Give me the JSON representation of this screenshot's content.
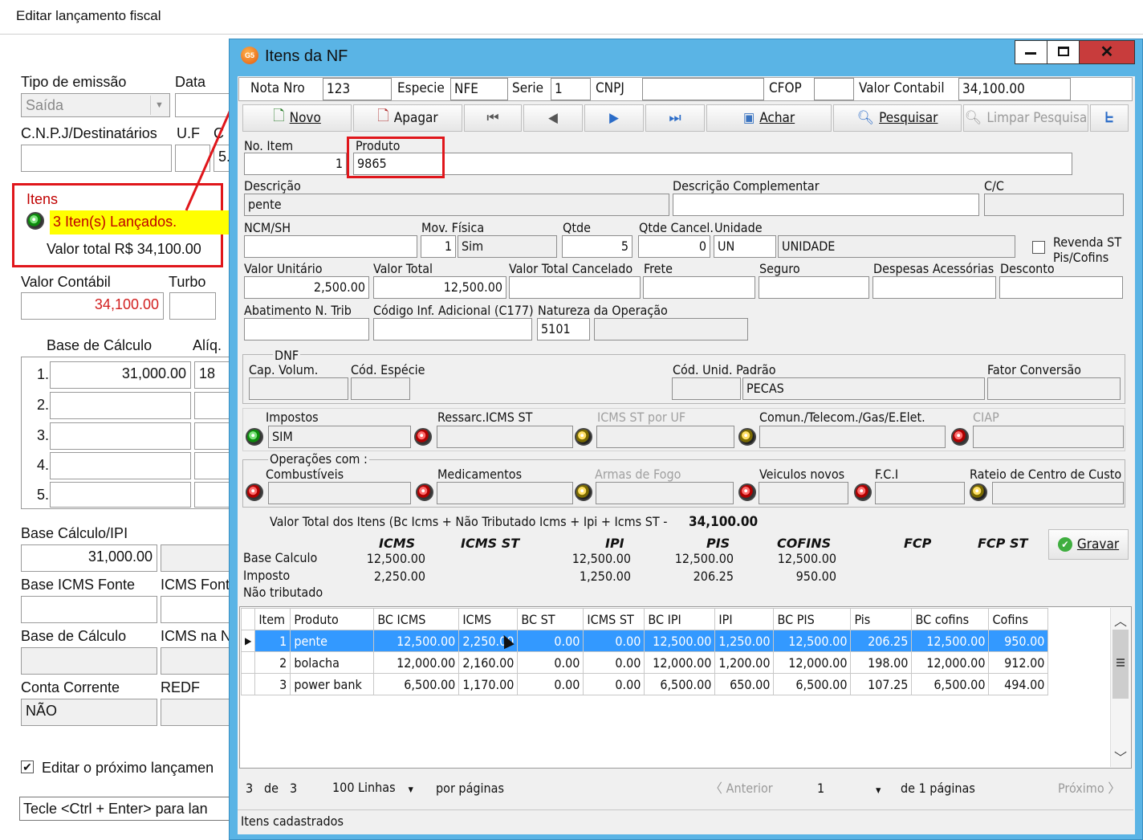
{
  "bg": {
    "title": "Editar lançamento fiscal",
    "tipo_emissao_label": "Tipo de emissão",
    "tipo_emissao_value": "Saída",
    "data_label": "Data",
    "cnpj_label": "C.N.P.J/Destinatários",
    "uf_label": "U.F",
    "c_label": "C",
    "s_value": "5.",
    "itens_label": "Itens",
    "itens_status": "3 Iten(s) Lançados.",
    "valor_total": "Valor total R$ 34,100.00",
    "valor_contabil_label": "Valor Contábil",
    "turbo_label": "Turbo",
    "valor_contabil_value": "34,100.00",
    "base_calc_label": "Base de Cálculo",
    "aliq_label": "Alíq.",
    "rows": [
      {
        "n": "1.",
        "base": "31,000.00",
        "aliq": "18"
      },
      {
        "n": "2.",
        "base": "",
        "aliq": ""
      },
      {
        "n": "3.",
        "base": "",
        "aliq": ""
      },
      {
        "n": "4.",
        "base": "",
        "aliq": ""
      },
      {
        "n": "5.",
        "base": "",
        "aliq": ""
      }
    ],
    "base_ipi_label": "Base Cálculo/IPI",
    "base_ipi_value": "31,000.00",
    "base_icms_fonte_label": "Base ICMS Fonte",
    "icms_fonte_label": "ICMS Font",
    "base_calc2_label": "Base de Cálculo",
    "icms_na_label": "ICMS na N",
    "conta_corrente_label": "Conta Corrente",
    "redf_label": "REDF",
    "conta_corrente_value": "NÃO",
    "editar_proximo": "Editar o próximo lançamen",
    "hint": "Tecle <Ctrl + Enter> para lan"
  },
  "dialog": {
    "title": "Itens da NF",
    "icon_text": "G5",
    "header": {
      "nota_label": "Nota Nro",
      "nota_value": "123",
      "especie_label": "Especie",
      "especie_value": "NFE",
      "serie_label": "Serie",
      "serie_value": "1",
      "cnpj_label": "CNPJ",
      "cnpj_value": "",
      "cfop_label": "CFOP",
      "cfop_value": "",
      "valor_contabil_label": "Valor Contabil",
      "valor_contabil_value": "34,100.00"
    },
    "toolbar": {
      "novo": "Novo",
      "apagar": "Apagar",
      "achar": "Achar",
      "pesquisar": "Pesquisar",
      "limpar": "Limpar Pesquisa"
    },
    "fields": {
      "no_item_label": "No. Item",
      "no_item_value": "1",
      "produto_label": "Produto",
      "produto_value": "9865",
      "descricao_label": "Descrição",
      "descricao_value": "pente",
      "desc_compl_label": "Descrição Complementar",
      "cc_label": "C/C",
      "ncm_label": "NCM/SH",
      "mov_fisica_label": "Mov. Física",
      "mov_fisica_num": "1",
      "mov_fisica_value": "Sim",
      "qtde_label": "Qtde",
      "qtde_value": "5",
      "qtde_cancel_label": "Qtde Cancel.",
      "qtde_cancel_value": "0",
      "unidade_label": "Unidade",
      "unidade_code": "UN",
      "unidade_desc": "UNIDADE",
      "revenda_label": "Revenda ST Pis/Cofins",
      "valor_unit_label": "Valor Unitário",
      "valor_unit_value": "2,500.00",
      "valor_total_label": "Valor Total",
      "valor_total_value": "12,500.00",
      "valor_total_cancel_label": "Valor Total Cancelado",
      "frete_label": "Frete",
      "seguro_label": "Seguro",
      "despesas_label": "Despesas Acessórias",
      "desconto_label": "Desconto",
      "abatimento_label": "Abatimento N. Trib",
      "cod_inf_label": "Código Inf. Adicional (C177)",
      "natureza_label": "Natureza da Operação",
      "natureza_value": "5101"
    },
    "dnf": {
      "title": "DNF",
      "cap_volum_label": "Cap. Volum.",
      "cod_especie_label": "Cód. Espécie",
      "cod_unid_label": "Cód. Unid. Padrão",
      "cod_unid_value": "PECAS",
      "fator_label": "Fator Conversão"
    },
    "impostos": {
      "impostos_label": "Impostos",
      "impostos_value": "SIM",
      "ressarc_label": "Ressarc.ICMS ST",
      "icms_st_uf_label": "ICMS ST por UF",
      "comun_label": "Comun./Telecom./Gas/E.Elet.",
      "ciap_label": "CIAP"
    },
    "operacoes": {
      "title": "Operações com :",
      "combustiveis": "Combustíveis",
      "medicamentos": "Medicamentos",
      "armas": "Armas de Fogo",
      "veiculos": "Veiculos novos",
      "fci": "F.C.I",
      "rateio": "Rateio de Centro de Custo"
    },
    "totals": {
      "label": "Valor Total dos Itens (Bc Icms + Não Tributado Icms + Ipi + Icms ST -",
      "value": "34,100.00",
      "headers": [
        "ICMS",
        "ICMS ST",
        "IPI",
        "PIS",
        "COFINS",
        "FCP",
        "FCP ST"
      ],
      "base_label": "Base Calculo",
      "imposto_label": "Imposto",
      "nao_trib_label": "Não tributado",
      "base": [
        "12,500.00",
        "",
        "12,500.00",
        "12,500.00",
        "12,500.00",
        "",
        ""
      ],
      "imposto": [
        "2,250.00",
        "",
        "1,250.00",
        "206.25",
        "950.00",
        "",
        ""
      ],
      "gravar": "Gravar"
    },
    "grid": {
      "columns": [
        "Item",
        "Produto",
        "BC ICMS",
        "ICMS",
        "BC ST",
        "ICMS ST",
        "BC IPI",
        "IPI",
        "BC PIS",
        "Pis",
        "BC cofins",
        "Cofins"
      ],
      "rows": [
        [
          "1",
          "pente",
          "12,500.00",
          "2,250.00",
          "0.00",
          "0.00",
          "12,500.00",
          "1,250.00",
          "12,500.00",
          "206.25",
          "12,500.00",
          "950.00"
        ],
        [
          "2",
          "bolacha",
          "12,000.00",
          "2,160.00",
          "0.00",
          "0.00",
          "12,000.00",
          "1,200.00",
          "12,000.00",
          "198.00",
          "12,000.00",
          "912.00"
        ],
        [
          "3",
          "power bank",
          "6,500.00",
          "1,170.00",
          "0.00",
          "0.00",
          "6,500.00",
          "650.00",
          "6,500.00",
          "107.25",
          "6,500.00",
          "494.00"
        ]
      ]
    },
    "pager": {
      "count": "3",
      "de": "de",
      "total": "3",
      "linhas": "100 Linhas",
      "por_paginas": "por páginas",
      "anterior": "Anterior",
      "page": "1",
      "de_paginas": "de 1 páginas",
      "proximo": "Próximo"
    },
    "status": "Itens cadastrados"
  },
  "colors": {
    "title_bar": "#5ab4e5",
    "highlight_red": "#e0161b",
    "selection": "#3399ff",
    "yellow": "#ffff00"
  }
}
